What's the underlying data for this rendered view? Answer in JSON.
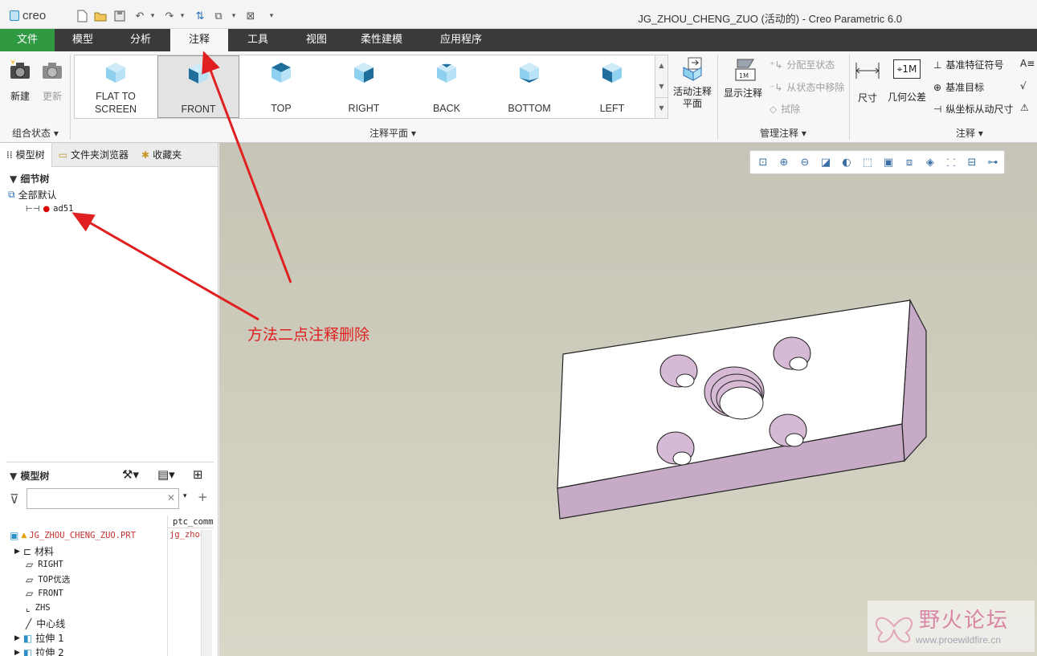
{
  "app": {
    "logo": "creo",
    "window_title": "JG_ZHOU_CHENG_ZUO (活动的) - Creo Parametric 6.0"
  },
  "menubar": {
    "tabs": [
      "文件",
      "模型",
      "分析",
      "注释",
      "工具",
      "视图",
      "柔性建模",
      "应用程序"
    ],
    "active": "注释"
  },
  "ribbon": {
    "combo_state": {
      "new_label": "新建",
      "update_label": "更新",
      "group_label": "组合状态"
    },
    "annotation_plane": {
      "items": [
        "FLAT TO\nSCREEN",
        "FRONT",
        "TOP",
        "RIGHT",
        "BACK",
        "BOTTOM",
        "LEFT"
      ],
      "selected": "FRONT",
      "active_plane_label": "活动注释\n平面",
      "group_label": "注释平面"
    },
    "manage": {
      "show_label": "显示注释",
      "assign_label": "分配至状态",
      "remove_label": "从状态中移除",
      "erase_label": "拭除",
      "group_label": "管理注释"
    },
    "annotation": {
      "dimension_label": "尺寸",
      "gtol_label": "几何公差",
      "gtol_icon_text": "1M",
      "datum_feature_label": "基准特征符号",
      "datum_target_label": "基准目标",
      "ordinate_label": "纵坐标从动尺寸",
      "group_label": "注释"
    }
  },
  "left_panel": {
    "tabs": [
      "模型树",
      "文件夹浏览器",
      "收藏夹"
    ],
    "detail_tree": {
      "header": "细节树",
      "root": "全部默认",
      "item": "ad51"
    },
    "model_tree": {
      "header": "模型树",
      "search_placeholder": "",
      "column_header": "ptc_commo",
      "column_value": "jg_zhou",
      "root": "JG_ZHOU_CHENG_ZUO.PRT",
      "items": [
        "材料",
        "RIGHT",
        "TOP优选",
        "FRONT",
        "ZHS",
        "中心线",
        "拉伸 1",
        "拉伸 2"
      ]
    }
  },
  "annotation_overlay": {
    "text": "方法二点注释删除",
    "color": "#e02020"
  },
  "watermark": {
    "title": "野火论坛",
    "url": "www.proewildfire.cn"
  },
  "colors": {
    "file_tab": "#2f9a42",
    "menubar": "#3a3a3a",
    "part_top": "#ffffff",
    "part_side": "#c7aac6",
    "arrow": "#e02020"
  }
}
